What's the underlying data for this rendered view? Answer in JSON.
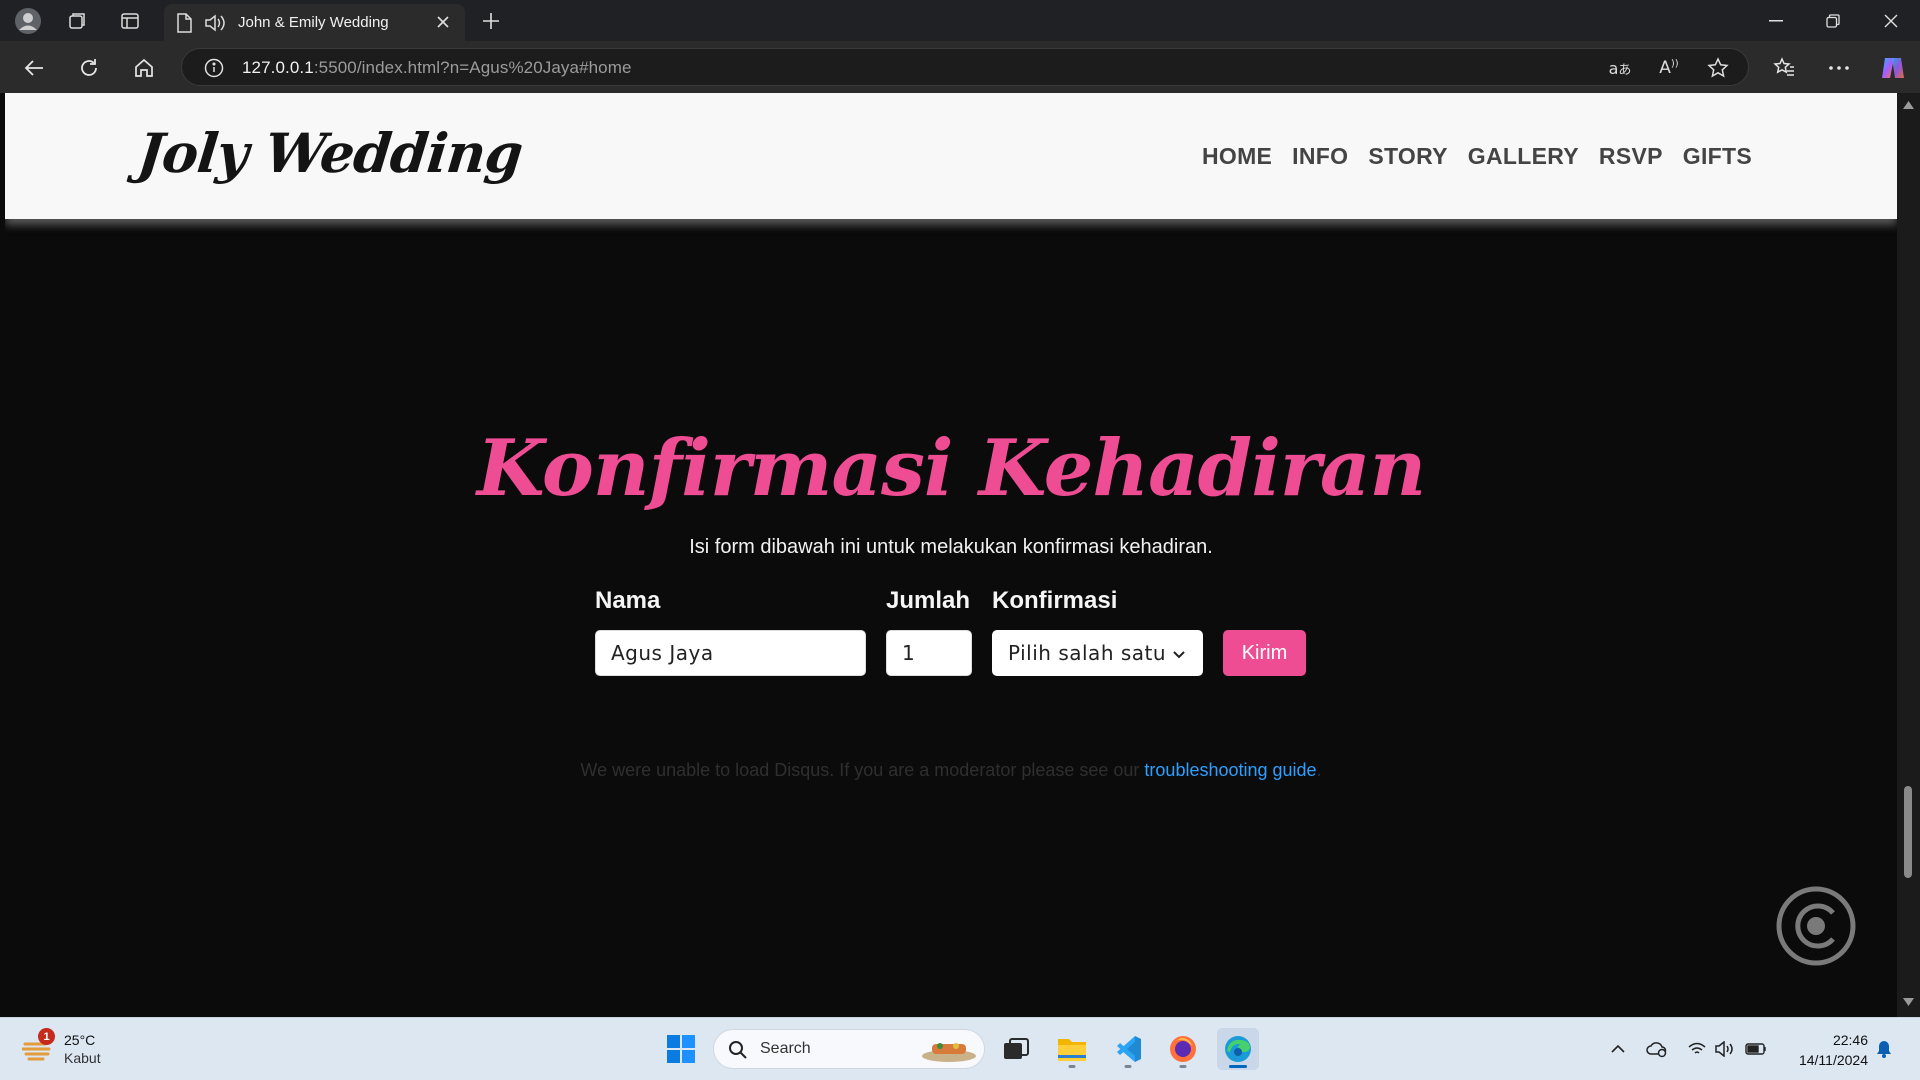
{
  "browser": {
    "tab_title": "John & Emily Wedding",
    "url_host": "127.0.0.1",
    "url_rest": ":5500/index.html?n=Agus%20Jaya#home"
  },
  "site": {
    "logo": "Joly Wedding",
    "nav": [
      "HOME",
      "INFO",
      "STORY",
      "GALLERY",
      "RSVP",
      "GIFTS"
    ]
  },
  "rsvp": {
    "title": "Konfirmasi Kehadiran",
    "subtitle": "Isi form dibawah ini untuk melakukan konfirmasi kehadiran.",
    "labels": {
      "name": "Nama",
      "count": "Jumlah",
      "confirm": "Konfirmasi"
    },
    "values": {
      "name": "Agus Jaya",
      "count": "1",
      "confirm": "Pilih salah satu"
    },
    "submit_label": "Kirim"
  },
  "disqus": {
    "message": "We were unable to load Disqus. If you are a moderator please see our ",
    "link": "troubleshooting guide",
    "end": "."
  },
  "taskbar": {
    "weather_temp": "25°C",
    "weather_cond": "Kabut",
    "weather_badge": "1",
    "search_placeholder": "Search",
    "time": "22:46",
    "date": "14/11/2024"
  },
  "colors": {
    "accent_pink": "#ee4d93",
    "link_blue": "#2e9fff",
    "page_bg": "#0b0b0b"
  }
}
